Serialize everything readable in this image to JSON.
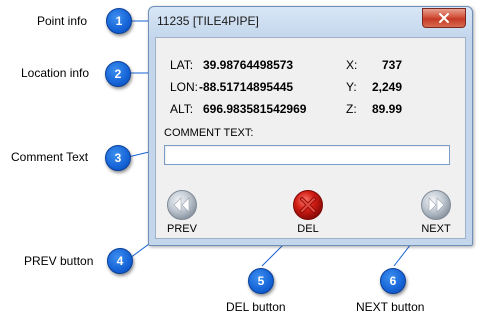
{
  "window": {
    "title": "11235 [TILE4PIPE]"
  },
  "location": {
    "lat_label": "LAT:",
    "lat_value": "39.98764498573",
    "lon_label": "LON:",
    "lon_value": "-88.51714895445",
    "alt_label": "ALT:",
    "alt_value": "696.983581542969",
    "x_label": "X:",
    "x_value": "737",
    "y_label": "Y:",
    "y_value": "2,249",
    "z_label": "Z:",
    "z_value": "89.99"
  },
  "comment": {
    "label": "COMMENT TEXT:",
    "value": ""
  },
  "buttons": {
    "prev_label": "PREV",
    "del_label": "DEL",
    "next_label": "NEXT"
  },
  "annotations": [
    {
      "number": "1",
      "text": "Point info"
    },
    {
      "number": "2",
      "text": "Location info"
    },
    {
      "number": "3",
      "text": "Comment Text"
    },
    {
      "number": "4",
      "text": "PREV button"
    },
    {
      "number": "5",
      "text": "DEL button"
    },
    {
      "number": "6",
      "text": "NEXT button"
    }
  ],
  "colors": {
    "badge_blue": "#1563d6",
    "del_red": "#c41414",
    "nav_gray": "#a9b3bd"
  }
}
